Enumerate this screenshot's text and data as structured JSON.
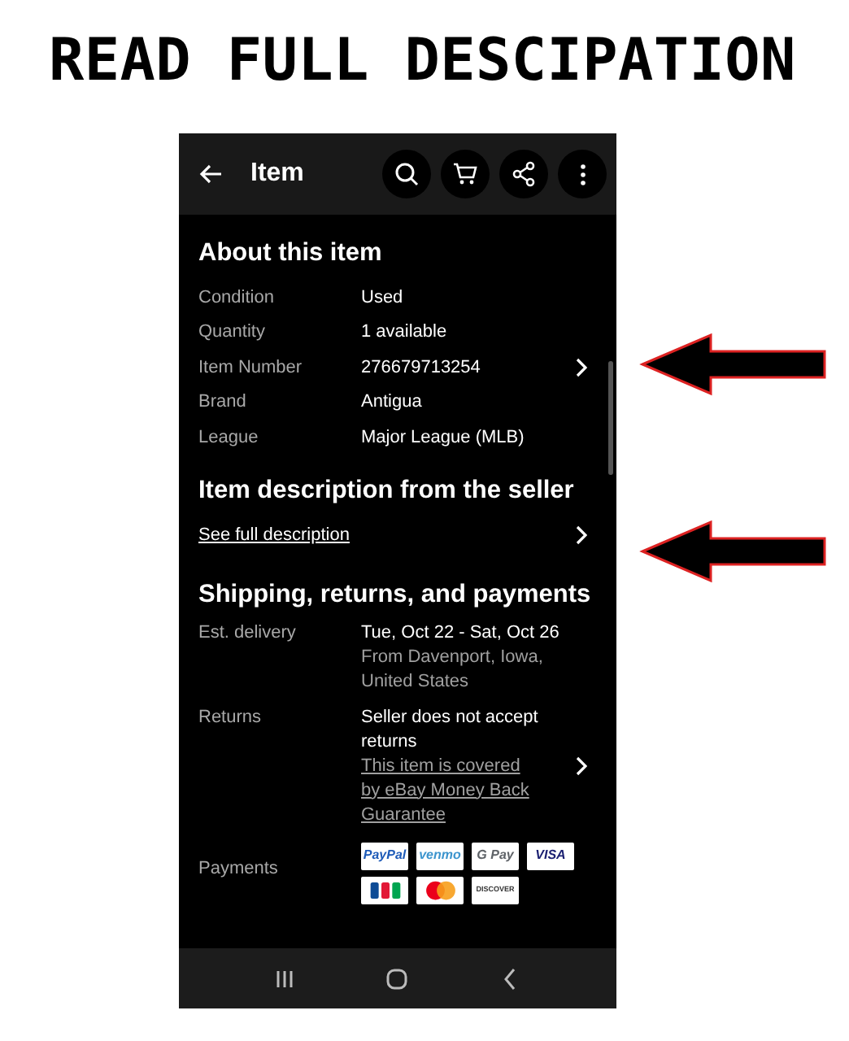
{
  "banner": {
    "title": "READ FULL DESCIPATION"
  },
  "app_bar": {
    "title": "Item"
  },
  "about": {
    "heading": "About this item",
    "rows": [
      {
        "label": "Condition",
        "value": "Used",
        "chevron": false
      },
      {
        "label": "Quantity",
        "value": "1 available",
        "chevron": false
      },
      {
        "label": "Item Number",
        "value": "276679713254",
        "chevron": true
      },
      {
        "label": "Brand",
        "value": "Antigua",
        "chevron": false
      },
      {
        "label": "League",
        "value": "Major League (MLB)",
        "chevron": false
      }
    ]
  },
  "description": {
    "heading": "Item description from the seller",
    "link": "See full description"
  },
  "shipping": {
    "heading": "Shipping, returns, and payments",
    "delivery": {
      "label": "Est. delivery",
      "value": "Tue, Oct 22 - Sat, Oct 26",
      "note": "From Davenport, Iowa, United States"
    },
    "returns": {
      "label": "Returns",
      "value": "Seller does not accept returns",
      "link": "This item is covered by eBay Money Back Guarantee"
    },
    "payments": {
      "label": "Payments",
      "methods": [
        {
          "kind": "text",
          "text": "PayPal",
          "color": "#1e5bb8"
        },
        {
          "kind": "text",
          "text": "venmo",
          "color": "#3d95ce"
        },
        {
          "kind": "text",
          "text": "G Pay",
          "color": "#5f6368"
        },
        {
          "kind": "text",
          "text": "VISA",
          "color": "#1a1f71"
        },
        {
          "kind": "jcb"
        },
        {
          "kind": "mastercard"
        },
        {
          "kind": "text",
          "text": "DISCOVER",
          "color": "#333333"
        }
      ]
    }
  }
}
